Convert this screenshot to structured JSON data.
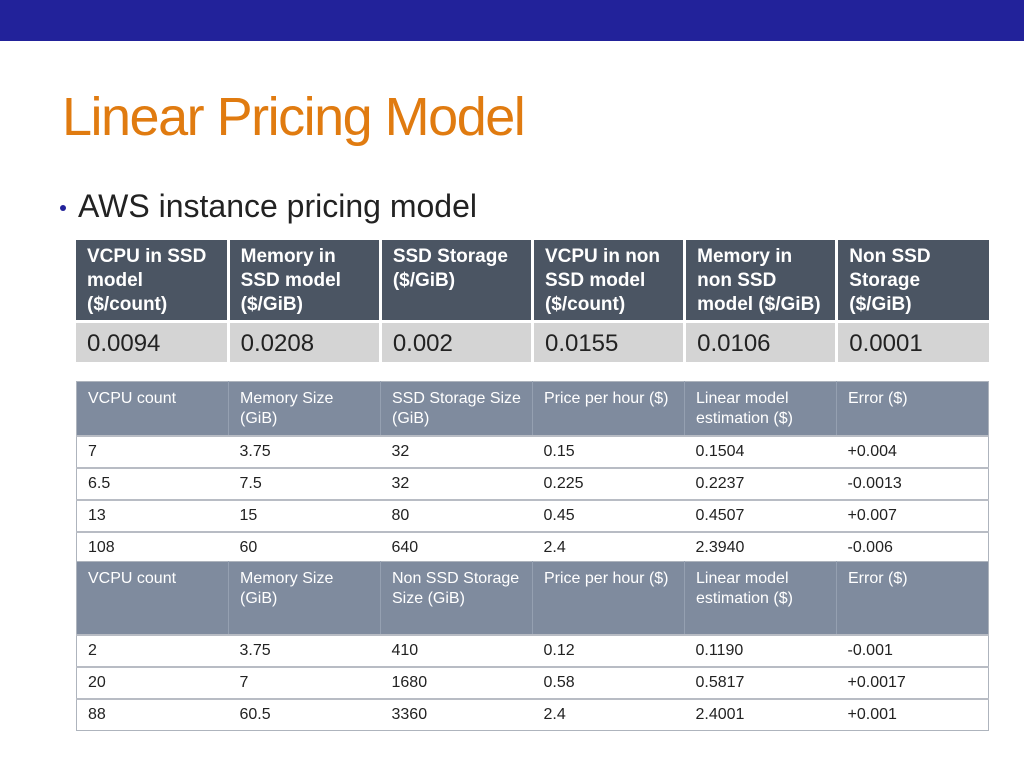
{
  "slide": {
    "title": "Linear Pricing Model",
    "bullet": "AWS instance pricing model",
    "colors": {
      "header_bar": "#22229a",
      "title": "#e07b10",
      "positive": "#1a8a1a",
      "negative": "#e0201c"
    }
  },
  "coefficients": {
    "headers": [
      "VCPU in SSD model ($/count)",
      "Memory in SSD model ($/GiB)",
      "SSD Storage ($/GiB)",
      "VCPU in non SSD model ($/count)",
      "Memory in non SSD model ($/GiB)",
      "Non SSD Storage ($/GiB)"
    ],
    "values": [
      "0.0094",
      "0.0208",
      "0.002",
      "0.0155",
      "0.0106",
      "0.0001"
    ]
  },
  "ssd_table": {
    "headers": [
      "VCPU count",
      "Memory Size (GiB)",
      "SSD Storage Size (GiB)",
      "Price per hour ($)",
      "Linear model estimation ($)",
      "Error ($)"
    ],
    "rows": [
      [
        "7",
        "3.75",
        "32",
        "0.15",
        "0.1504",
        "+0.004"
      ],
      [
        "6.5",
        "7.5",
        "32",
        "0.225",
        "0.2237",
        "-0.0013"
      ],
      [
        "13",
        "15",
        "80",
        "0.45",
        "0.4507",
        "+0.007"
      ],
      [
        "108",
        "60",
        "640",
        "2.4",
        "2.3940",
        "-0.006"
      ]
    ]
  },
  "non_ssd_table": {
    "headers": [
      "VCPU count",
      "Memory Size (GiB)",
      "Non SSD Storage Size (GiB)",
      "Price per hour ($)",
      "Linear model estimation ($)",
      "Error ($)"
    ],
    "rows": [
      [
        "2",
        "3.75",
        "410",
        "0.12",
        "0.1190",
        "-0.001"
      ],
      [
        "20",
        "7",
        "1680",
        "0.58",
        "0.5817",
        "+0.0017"
      ],
      [
        "88",
        "60.5",
        "3360",
        "2.4",
        "2.4001",
        "+0.001"
      ]
    ]
  }
}
